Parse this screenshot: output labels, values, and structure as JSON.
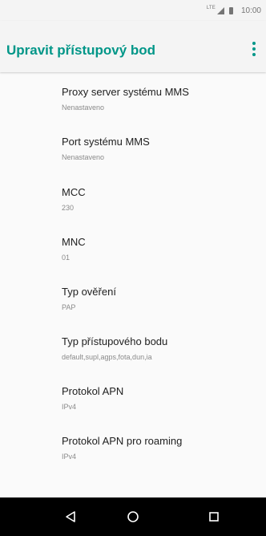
{
  "status_bar": {
    "network": "LTE",
    "time": "10:00"
  },
  "app_bar": {
    "title": "Upravit přístupový bod",
    "menu_icon": "more-vert-icon"
  },
  "colors": {
    "accent": "#009688",
    "background": "#fafafa",
    "nav_bar": "#000000"
  },
  "preferences": [
    {
      "title": "Proxy server systému MMS",
      "summary": "Nenastaveno"
    },
    {
      "title": "Port systému MMS",
      "summary": "Nenastaveno"
    },
    {
      "title": "MCC",
      "summary": "230"
    },
    {
      "title": "MNC",
      "summary": "01"
    },
    {
      "title": "Typ ověření",
      "summary": "PAP"
    },
    {
      "title": "Typ přístupového bodu",
      "summary": "default,supl,agps,fota,dun,ia"
    },
    {
      "title": "Protokol APN",
      "summary": "IPv4"
    },
    {
      "title": "Protokol APN pro roaming",
      "summary": "IPv4"
    }
  ],
  "navigation": {
    "back_icon": "back-triangle-icon",
    "home_icon": "home-circle-icon",
    "recents_icon": "recents-square-icon"
  }
}
